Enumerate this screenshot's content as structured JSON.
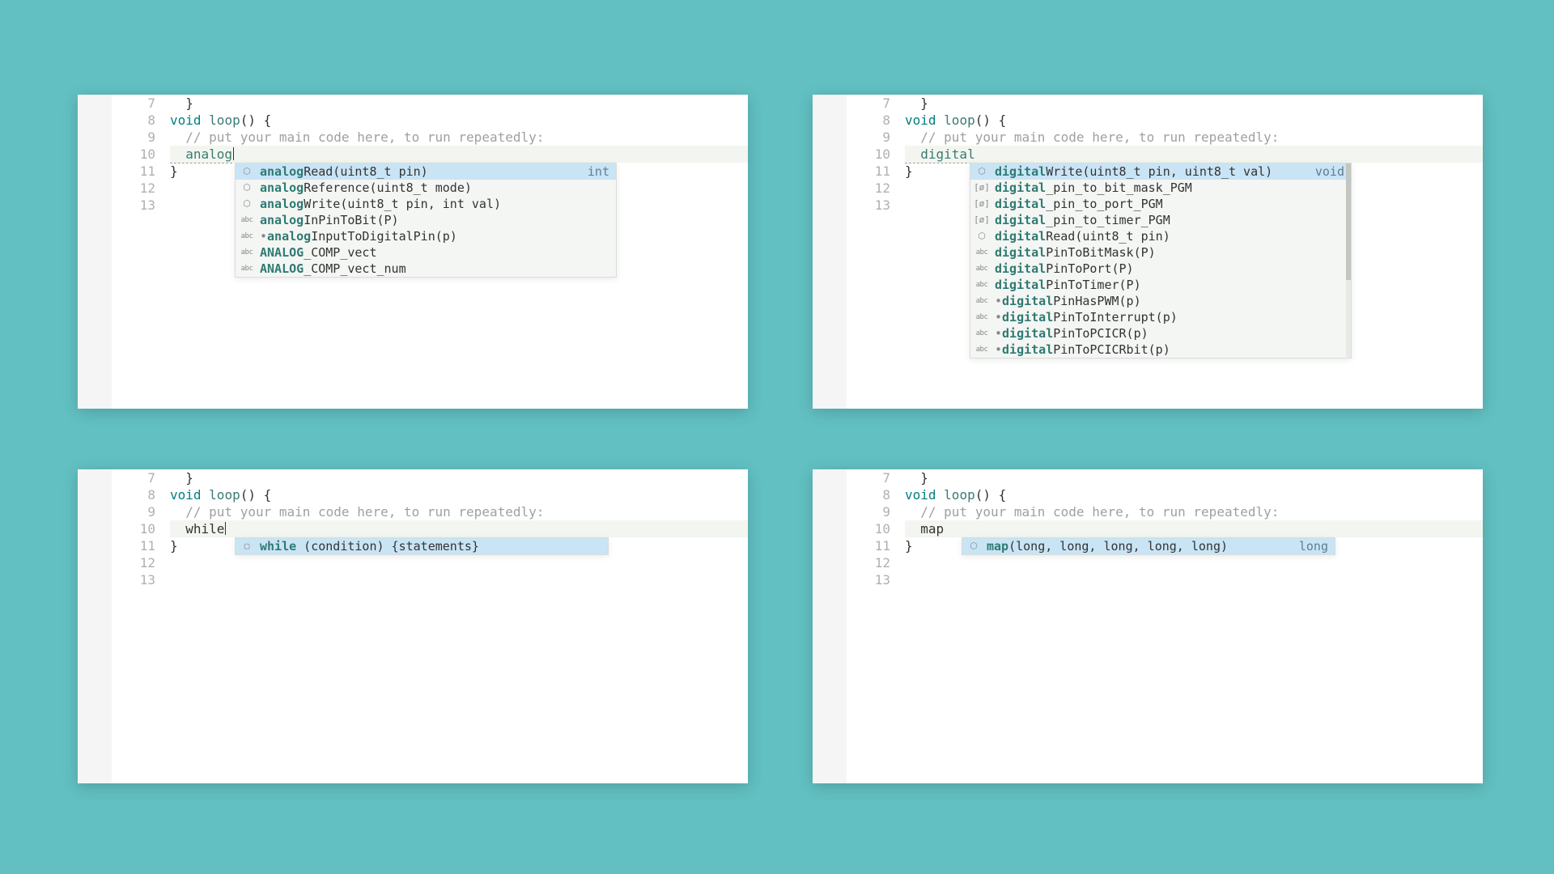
{
  "colors": {
    "background": "#62c0c2",
    "editor_bg": "#ffffff",
    "gutter_fg": "#b0b0b0",
    "comment": "#a0a0a0",
    "keyword": "#3b7a73",
    "popup_bg": "#f4f6f3",
    "popup_selected": "#c9e4f5"
  },
  "line_numbers": [
    "7",
    "8",
    "9",
    "10",
    "11",
    "12",
    "13"
  ],
  "code": {
    "line7": "  }",
    "line8_type": "void ",
    "line8_name": "loop",
    "line8_tail": "() {",
    "line9": "  // put your main code here, to run repeatedly:",
    "line11": "}",
    "panel1_typed": "  analog",
    "panel2_typed": "  digital",
    "panel3_typed": "  while",
    "panel4_typed": "  map"
  },
  "popup1": {
    "items": [
      {
        "icon": "cube",
        "match": "analog",
        "rest": "Read(uint8_t pin)",
        "ret": "int",
        "selected": true
      },
      {
        "icon": "cube",
        "match": "analog",
        "rest": "Reference(uint8_t mode)"
      },
      {
        "icon": "cube",
        "match": "analog",
        "rest": "Write(uint8_t pin, int val)"
      },
      {
        "icon": "abc",
        "match": "analog",
        "rest": "InPinToBit(P)"
      },
      {
        "icon": "abc",
        "dot": true,
        "match": "analog",
        "rest": "InputToDigitalPin(p)"
      },
      {
        "icon": "abc",
        "match": "ANALOG",
        "rest": "_COMP_vect"
      },
      {
        "icon": "abc",
        "match": "ANALOG",
        "rest": "_COMP_vect_num"
      }
    ]
  },
  "popup2": {
    "items": [
      {
        "icon": "cube",
        "match": "digital",
        "rest": "Write(uint8_t pin, uint8_t val)",
        "ret": "void",
        "selected": true
      },
      {
        "icon": "bracket",
        "match": "digital",
        "rest": "_pin_to_bit_mask_PGM"
      },
      {
        "icon": "bracket",
        "match": "digital",
        "rest": "_pin_to_port_PGM"
      },
      {
        "icon": "bracket",
        "match": "digital",
        "rest": "_pin_to_timer_PGM"
      },
      {
        "icon": "cube",
        "match": "digital",
        "rest": "Read(uint8_t pin)"
      },
      {
        "icon": "abc",
        "match": "digital",
        "rest": "PinToBitMask(P)"
      },
      {
        "icon": "abc",
        "match": "digital",
        "rest": "PinToPort(P)"
      },
      {
        "icon": "abc",
        "match": "digital",
        "rest": "PinToTimer(P)"
      },
      {
        "icon": "abc",
        "dot": true,
        "match": "digital",
        "rest": "PinHasPWM(p)"
      },
      {
        "icon": "abc",
        "dot": true,
        "match": "digital",
        "rest": "PinToInterrupt(p)"
      },
      {
        "icon": "abc",
        "dot": true,
        "match": "digital",
        "rest": "PinToPCICR(p)"
      },
      {
        "icon": "abc",
        "dot": true,
        "match": "digital",
        "rest": "PinToPCICRbit(p)"
      }
    ]
  },
  "popup3": {
    "items": [
      {
        "icon": "snippet",
        "match": "while",
        "rest": " (condition) {statements}",
        "selected": true
      }
    ]
  },
  "popup4": {
    "items": [
      {
        "icon": "cube",
        "match": "map",
        "rest": "(long, long, long, long, long)",
        "ret": "long",
        "selected": true
      }
    ]
  }
}
